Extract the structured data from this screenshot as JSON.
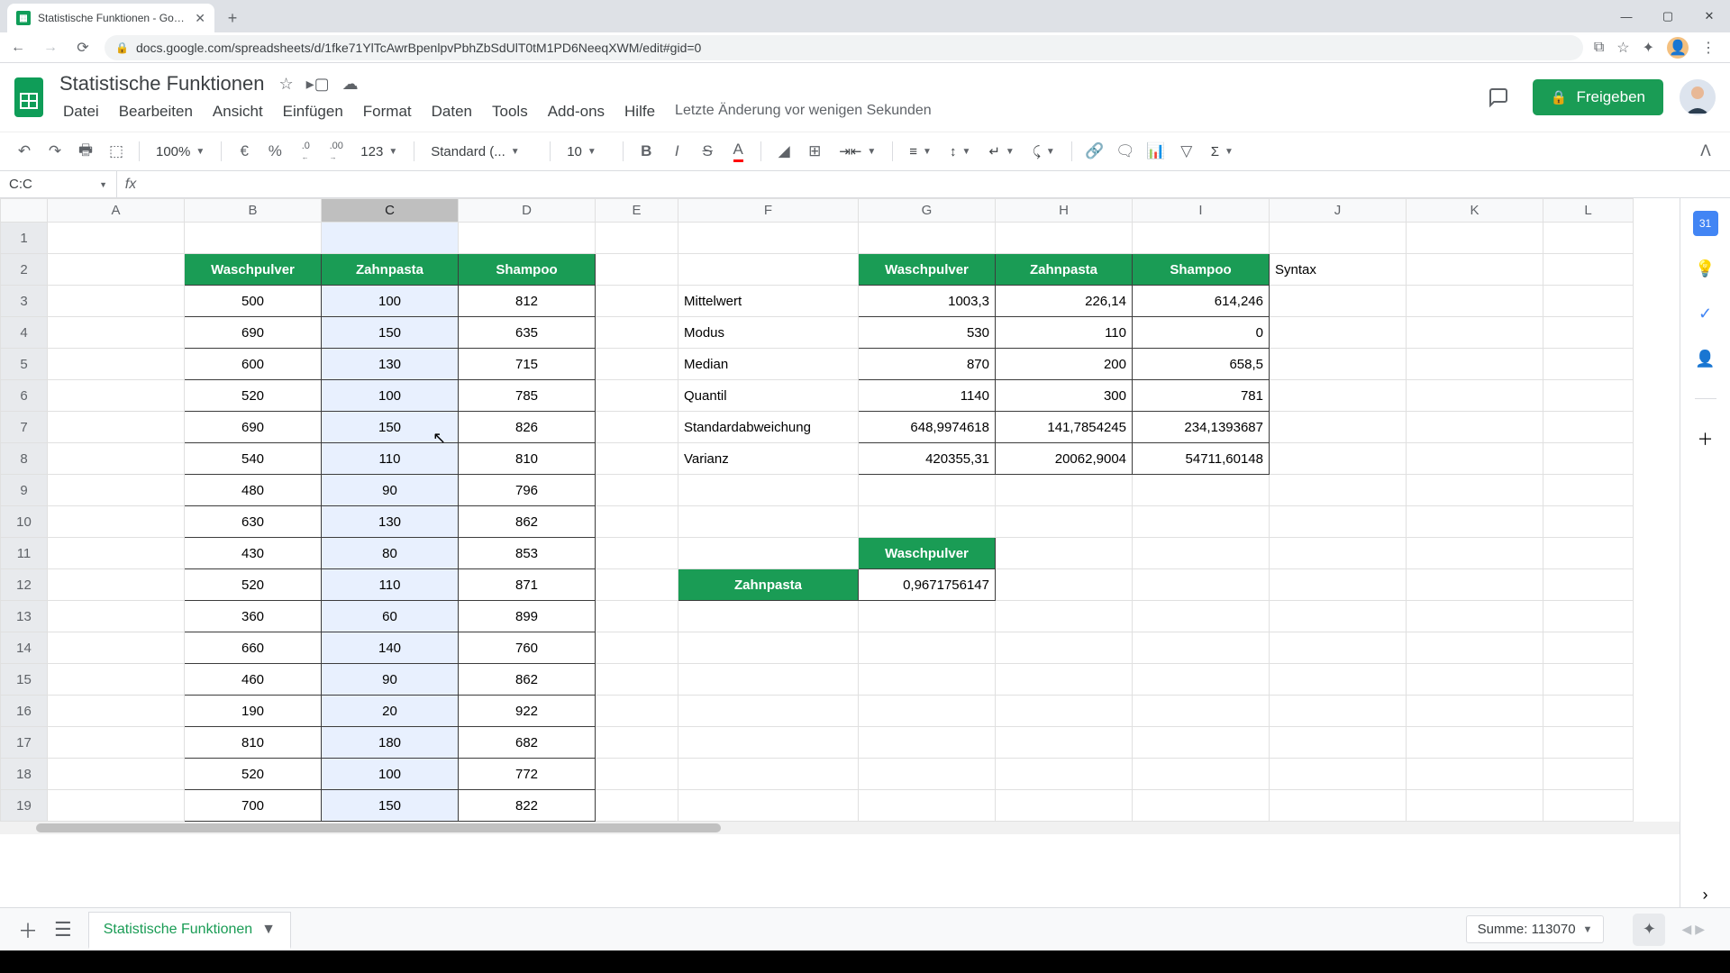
{
  "browser": {
    "tab_title": "Statistische Funktionen - Google",
    "url": "docs.google.com/spreadsheets/d/1fke71YlTcAwrBpenlpvPbhZbSdUlT0tM1PD6NeeqXWM/edit#gid=0",
    "minimize": "—",
    "maximize": "▢",
    "close": "✕"
  },
  "doc": {
    "title": "Statistische Funktionen",
    "menus": [
      "Datei",
      "Bearbeiten",
      "Ansicht",
      "Einfügen",
      "Format",
      "Daten",
      "Tools",
      "Add-ons",
      "Hilfe"
    ],
    "last_edit": "Letzte Änderung vor wenigen Sekunden",
    "share": "Freigeben"
  },
  "toolbar": {
    "zoom": "100%",
    "currency": "€",
    "percent": "%",
    "dec_less": ".0",
    "dec_more": ".00",
    "numfmt": "123",
    "font": "Standard (...",
    "fontsize": "10"
  },
  "namebox": {
    "ref": "C:C",
    "formula": ""
  },
  "columns": [
    "A",
    "B",
    "C",
    "D",
    "E",
    "F",
    "G",
    "H",
    "I",
    "J",
    "K",
    "L"
  ],
  "col_widths": {
    "A": 152,
    "B": 152,
    "C": 152,
    "D": 152,
    "E": 92,
    "F": 200,
    "G": 152,
    "H": 152,
    "I": 152,
    "J": 152,
    "K": 152,
    "L": 100
  },
  "selected_col_index": 2,
  "rows": [
    {
      "n": 1,
      "cells": [
        "",
        "",
        "",
        "",
        "",
        "",
        "",
        "",
        "",
        "",
        "",
        ""
      ]
    },
    {
      "n": 2,
      "cells": [
        "",
        "Waschpulver",
        "Zahnpasta",
        "Shampoo",
        "",
        "",
        "Waschpulver",
        "Zahnpasta",
        "Shampoo",
        "Syntax",
        "",
        ""
      ]
    },
    {
      "n": 3,
      "cells": [
        "",
        "500",
        "100",
        "812",
        "",
        "Mittelwert",
        "1003,3",
        "226,14",
        "614,246",
        "",
        "",
        ""
      ]
    },
    {
      "n": 4,
      "cells": [
        "",
        "690",
        "150",
        "635",
        "",
        "Modus",
        "530",
        "110",
        "0",
        "",
        "",
        ""
      ]
    },
    {
      "n": 5,
      "cells": [
        "",
        "600",
        "130",
        "715",
        "",
        "Median",
        "870",
        "200",
        "658,5",
        "",
        "",
        ""
      ]
    },
    {
      "n": 6,
      "cells": [
        "",
        "520",
        "100",
        "785",
        "",
        "Quantil",
        "1140",
        "300",
        "781",
        "",
        "",
        ""
      ]
    },
    {
      "n": 7,
      "cells": [
        "",
        "690",
        "150",
        "826",
        "",
        "Standardabweichung",
        "648,9974618",
        "141,7854245",
        "234,1393687",
        "",
        "",
        ""
      ]
    },
    {
      "n": 8,
      "cells": [
        "",
        "540",
        "110",
        "810",
        "",
        "Varianz",
        "420355,31",
        "20062,9004",
        "54711,60148",
        "",
        "",
        ""
      ]
    },
    {
      "n": 9,
      "cells": [
        "",
        "480",
        "90",
        "796",
        "",
        "",
        "",
        "",
        "",
        "",
        "",
        ""
      ]
    },
    {
      "n": 10,
      "cells": [
        "",
        "630",
        "130",
        "862",
        "",
        "",
        "",
        "",
        "",
        "",
        "",
        ""
      ]
    },
    {
      "n": 11,
      "cells": [
        "",
        "430",
        "80",
        "853",
        "",
        "",
        "Waschpulver",
        "",
        "",
        "",
        "",
        ""
      ]
    },
    {
      "n": 12,
      "cells": [
        "",
        "520",
        "110",
        "871",
        "",
        "Zahnpasta",
        "0,9671756147",
        "",
        "",
        "",
        "",
        ""
      ]
    },
    {
      "n": 13,
      "cells": [
        "",
        "360",
        "60",
        "899",
        "",
        "",
        "",
        "",
        "",
        "",
        "",
        ""
      ]
    },
    {
      "n": 14,
      "cells": [
        "",
        "660",
        "140",
        "760",
        "",
        "",
        "",
        "",
        "",
        "",
        "",
        ""
      ]
    },
    {
      "n": 15,
      "cells": [
        "",
        "460",
        "90",
        "862",
        "",
        "",
        "",
        "",
        "",
        "",
        "",
        ""
      ]
    },
    {
      "n": 16,
      "cells": [
        "",
        "190",
        "20",
        "922",
        "",
        "",
        "",
        "",
        "",
        "",
        "",
        ""
      ]
    },
    {
      "n": 17,
      "cells": [
        "",
        "810",
        "180",
        "682",
        "",
        "",
        "",
        "",
        "",
        "",
        "",
        ""
      ]
    },
    {
      "n": 18,
      "cells": [
        "",
        "520",
        "100",
        "772",
        "",
        "",
        "",
        "",
        "",
        "",
        "",
        ""
      ]
    },
    {
      "n": 19,
      "cells": [
        "",
        "700",
        "150",
        "822",
        "",
        "",
        "",
        "",
        "",
        "",
        "",
        ""
      ]
    }
  ],
  "status": {
    "sum_label": "Summe: 113070"
  },
  "sheet_tab": "Statistische Funktionen"
}
